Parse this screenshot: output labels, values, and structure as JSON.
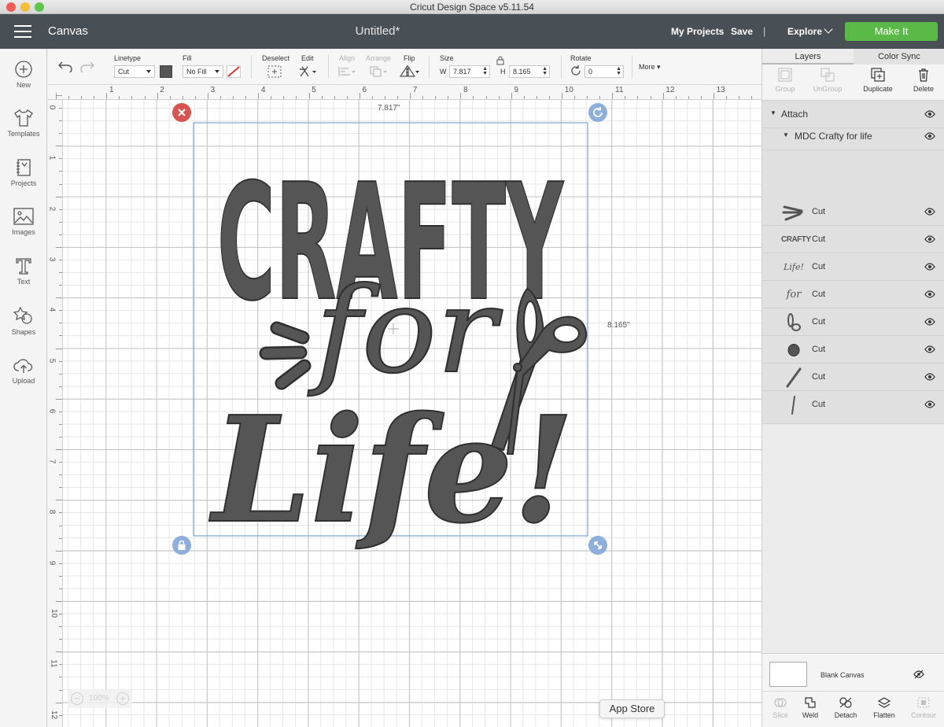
{
  "window": {
    "title": "Cricut Design Space  v5.11.54"
  },
  "header": {
    "canvas_label": "Canvas",
    "doc_title": "Untitled*",
    "my_projects": "My Projects",
    "save": "Save",
    "separator": "|",
    "explore": "Explore",
    "make_it": "Make It",
    "accent": "#5bb947",
    "bg": "#485055"
  },
  "sidebar": {
    "items": [
      {
        "label": "New",
        "icon": "plus-circle-icon"
      },
      {
        "label": "Templates",
        "icon": "tshirt-icon"
      },
      {
        "label": "Projects",
        "icon": "notebook-icon"
      },
      {
        "label": "Images",
        "icon": "picture-icon"
      },
      {
        "label": "Text",
        "icon": "text-icon"
      },
      {
        "label": "Shapes",
        "icon": "shapes-icon"
      },
      {
        "label": "Upload",
        "icon": "cloud-upload-icon"
      }
    ]
  },
  "toolbar": {
    "linetype_label": "Linetype",
    "linetype_value": "Cut",
    "fill_label": "Fill",
    "fill_value": "No Fill",
    "deselect_label": "Deselect",
    "edit_label": "Edit",
    "align_label": "Align",
    "arrange_label": "Arrange",
    "flip_label": "Flip",
    "size_label": "Size",
    "w_label": "W",
    "w_value": "7.817",
    "h_label": "H",
    "h_value": "8.165",
    "rotate_label": "Rotate",
    "rotate_value": "0",
    "more_label": "More",
    "swatch_color": "#555555"
  },
  "ruler": {
    "top": [
      "1",
      "2",
      "3",
      "4",
      "5",
      "6",
      "7",
      "8",
      "9",
      "10",
      "11",
      "12",
      "13"
    ],
    "left": [
      "0",
      "1",
      "2",
      "3",
      "4",
      "5",
      "6",
      "7",
      "8",
      "9",
      "10",
      "11",
      "12"
    ]
  },
  "canvas": {
    "width_label": "7.817\"",
    "height_label": "8.165\"",
    "design_lines": [
      "CRAFTY",
      "for",
      "Life!"
    ],
    "design_color": "#555555",
    "zoom_value": "100%",
    "app_store": "App Store"
  },
  "panel": {
    "tabs": [
      "Layers",
      "Color Sync"
    ],
    "tools": [
      "Group",
      "UnGroup",
      "Duplicate",
      "Delete"
    ],
    "attach_label": "Attach",
    "group_name": "MDC Crafty for life",
    "layers": [
      {
        "thumb": "burst-lines",
        "label": "Cut"
      },
      {
        "thumb": "crafty-text",
        "label": "Cut"
      },
      {
        "thumb": "life-text",
        "label": "Cut"
      },
      {
        "thumb": "for-text",
        "label": "Cut"
      },
      {
        "thumb": "scissor-handles",
        "label": "Cut"
      },
      {
        "thumb": "dot",
        "label": "Cut"
      },
      {
        "thumb": "blade",
        "label": "Cut"
      },
      {
        "thumb": "stroke",
        "label": "Cut"
      }
    ],
    "thumb_labels": {
      "crafty": "CRAFTY",
      "life": "Life!",
      "for": "for"
    },
    "blank_canvas": "Blank Canvas",
    "bottom_tools": [
      "Slice",
      "Weld",
      "Detach",
      "Flatten",
      "Contour"
    ]
  }
}
